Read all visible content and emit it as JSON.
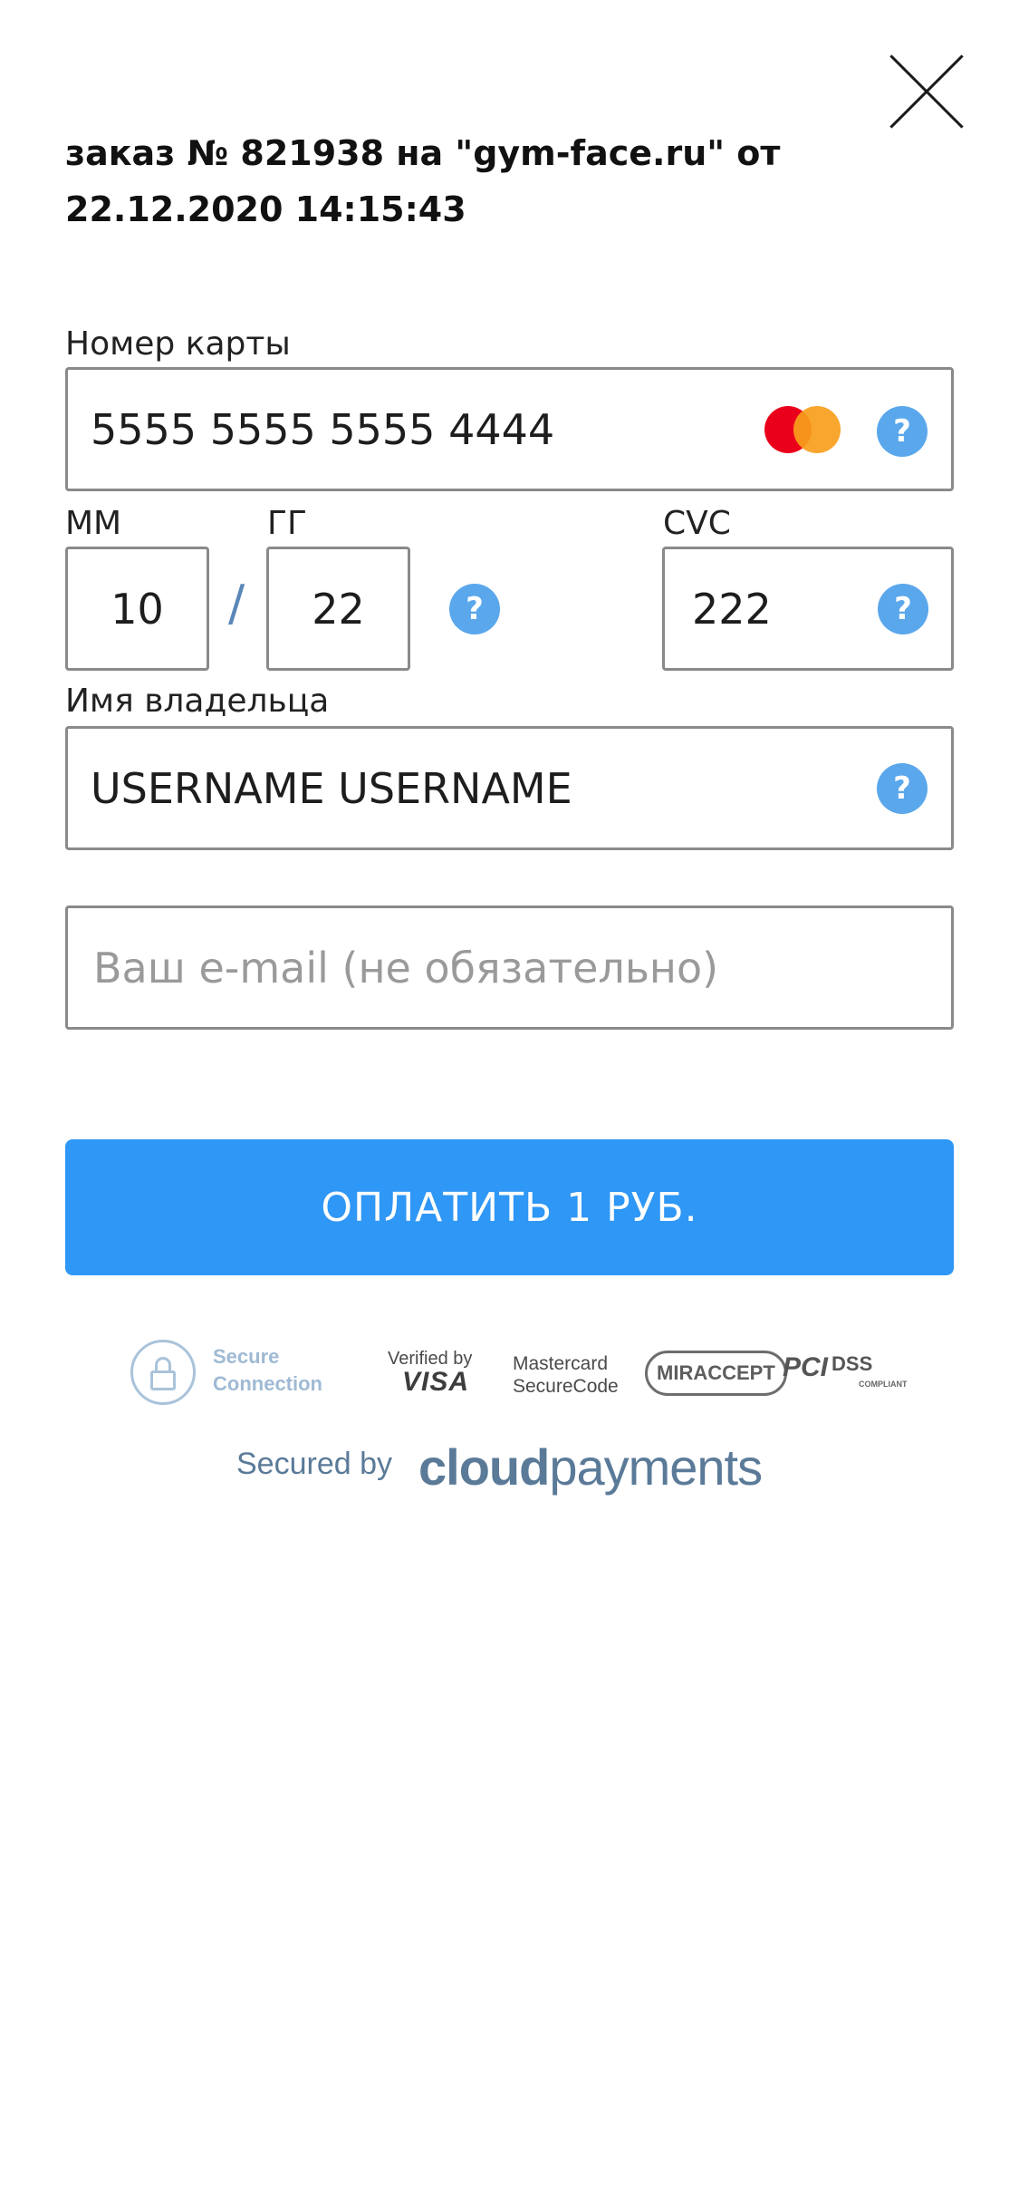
{
  "order": {
    "title": "заказ № 821938 на \"gym-face.ru\" от 22.12.2020 14:15:43"
  },
  "card_number": {
    "label": "Номер карты",
    "value": "5555 5555 5555 4444"
  },
  "expiry": {
    "month_label": "ММ",
    "month_value": "10",
    "year_label": "ГГ",
    "year_value": "22",
    "separator": "/"
  },
  "cvc": {
    "label": "CVC",
    "value": "222"
  },
  "holder": {
    "label": "Имя владельца",
    "value": "USERNAME USERNAME"
  },
  "email": {
    "placeholder": "Ваш e-mail (не обязательно)",
    "value": ""
  },
  "pay_button": {
    "label": "ОПЛАТИТЬ 1 РУБ."
  },
  "help": {
    "glyph": "?"
  },
  "badges": {
    "secure_line1": "Secure",
    "secure_line2": "Connection",
    "visa_small": "Verified by",
    "visa_big": "VISA",
    "mastercard_line1": "Mastercard",
    "mastercard_line2": "SecureCode",
    "mir": "MIRACCEPT",
    "pci": "PCI",
    "dss": "DSS",
    "compliant": "COMPLIANT"
  },
  "footer": {
    "secured_by": "Secured by",
    "brand_part1": "cloud",
    "brand_part2": "payments"
  },
  "icons": {
    "close": "close-icon",
    "help": "help-icon",
    "card_brand": "mastercard-logo",
    "lock": "lock-icon"
  },
  "colors": {
    "accent": "#2f97f5",
    "help": "#5aa7ec",
    "brand": "#5a7a98"
  }
}
